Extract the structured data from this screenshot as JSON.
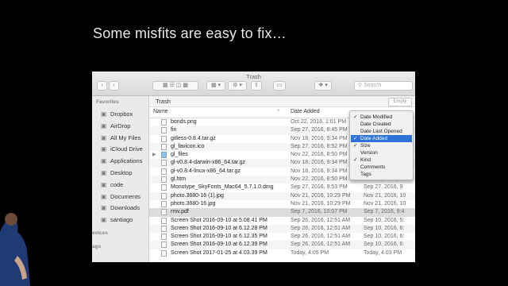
{
  "slide": {
    "title": "Some misfits are easy to fix…"
  },
  "window": {
    "title": "Trash",
    "search_placeholder": "Search"
  },
  "sidebar": {
    "favorites_label": "Favorites",
    "items": [
      {
        "label": "Dropbox",
        "icon": "dropbox-icon"
      },
      {
        "label": "AirDrop",
        "icon": "airdrop-icon"
      },
      {
        "label": "All My Files",
        "icon": "all-files-icon"
      },
      {
        "label": "iCloud Drive",
        "icon": "icloud-icon"
      },
      {
        "label": "Applications",
        "icon": "applications-icon"
      },
      {
        "label": "Desktop",
        "icon": "desktop-icon"
      },
      {
        "label": "code",
        "icon": "folder-icon"
      },
      {
        "label": "Documents",
        "icon": "documents-icon"
      },
      {
        "label": "Downloads",
        "icon": "downloads-icon"
      },
      {
        "label": "santiago",
        "icon": "home-icon"
      }
    ],
    "devices_label": "evices",
    "tags_label": "ags"
  },
  "pathbar": {
    "label": "Trash",
    "empty_button": "Empty"
  },
  "columns": {
    "name": "Name",
    "date_added": "Date Added"
  },
  "files": [
    {
      "name": "bonds.png",
      "date_added": "Oct 22, 2016, 1:01 PM",
      "date2": "Oct 22, 2016, 1",
      "type": "file"
    },
    {
      "name": "fin",
      "date_added": "Sep 27, 2016, 8:45 PM",
      "date2": "Sep 27, 2016, 8",
      "type": "file"
    },
    {
      "name": "gitless-0.8.4.tar.gz",
      "date_added": "Nov 18, 2016, 9:34 PM",
      "date2": "Nov 18, 2016, 9",
      "type": "file"
    },
    {
      "name": "gl_favicon.ico",
      "date_added": "Sep 27, 2016, 8:52 PM",
      "date2": "Sep 27, 2016, 8",
      "type": "file"
    },
    {
      "name": "gl_files",
      "date_added": "Nov 22, 2016, 8:50 PM",
      "date2": "Nov 22, 2016, 8",
      "type": "folder"
    },
    {
      "name": "gl-v0.8.4-darwin-x86_64.tar.gz",
      "date_added": "Nov 18, 2016, 9:34 PM",
      "date2": "Nov 18, 2016, 9",
      "type": "file"
    },
    {
      "name": "gl-v0.8.4-linux-x86_64.tar.gz",
      "date_added": "Nov 18, 2016, 9:34 PM",
      "date2": "Nov 18, 2016, 9",
      "type": "file"
    },
    {
      "name": "gl.htm",
      "date_added": "Nov 22, 2016, 8:50 PM",
      "date2": "Nov 22, 2016, 8",
      "type": "file"
    },
    {
      "name": "Monotype_SkyFonts_Mac64_5.7.1.0.dmg",
      "date_added": "Sep 27, 2016, 9:53 PM",
      "date2": "Sep 27, 2016, 9",
      "type": "file"
    },
    {
      "name": "photo.3680-16 (1).jpg",
      "date_added": "Nov 21, 2016, 10:29 PM",
      "date2": "Nov 21, 2016, 10",
      "type": "file"
    },
    {
      "name": "photo.3680-16.jpg",
      "date_added": "Nov 21, 2016, 10:29 PM",
      "date2": "Nov 21, 2016, 10",
      "type": "file"
    },
    {
      "name": "rmv.pdf",
      "date_added": "Sep 7, 2016, 10:07 PM",
      "date2": "Sep 7, 2016, 9:4",
      "type": "file"
    },
    {
      "name": "Screen Shot 2016-09-10 at 5.08.41 PM",
      "date_added": "Sep 26, 2016, 12:51 AM",
      "date2": "Sep 10, 2016, 5:",
      "type": "file"
    },
    {
      "name": "Screen Shot 2016-09-10 at 6.12.28 PM",
      "date_added": "Sep 26, 2016, 12:51 AM",
      "date2": "Sep 10, 2016, 6:",
      "type": "file"
    },
    {
      "name": "Screen Shot 2016-09-10 at 6.12.35 PM",
      "date_added": "Sep 26, 2016, 12:51 AM",
      "date2": "Sep 10, 2016, 6:",
      "type": "file"
    },
    {
      "name": "Screen Shot 2016-09-10 at 6.12.39 PM",
      "date_added": "Sep 26, 2016, 12:51 AM",
      "date2": "Sep 10, 2016, 6:",
      "type": "file"
    },
    {
      "name": "Screen Shot 2017-01-25 at 4.03.39 PM",
      "date_added": "Today, 4:05 PM",
      "date2": "Today, 4:03 PM",
      "type": "file"
    }
  ],
  "column_menu": {
    "items": [
      {
        "label": "Date Modified",
        "check": "✓"
      },
      {
        "label": "Date Created",
        "check": ""
      },
      {
        "label": "Date Last Opened",
        "check": ""
      },
      {
        "label": "Date Added",
        "check": "✓"
      },
      {
        "label": "Size",
        "check": "✓"
      },
      {
        "label": "Version",
        "check": ""
      },
      {
        "label": "Kind",
        "check": "✓"
      },
      {
        "label": "Comments",
        "check": ""
      },
      {
        "label": "Tags",
        "check": ""
      }
    ],
    "highlighted": "Date Added",
    "highlight_color": "#2f72d8"
  }
}
